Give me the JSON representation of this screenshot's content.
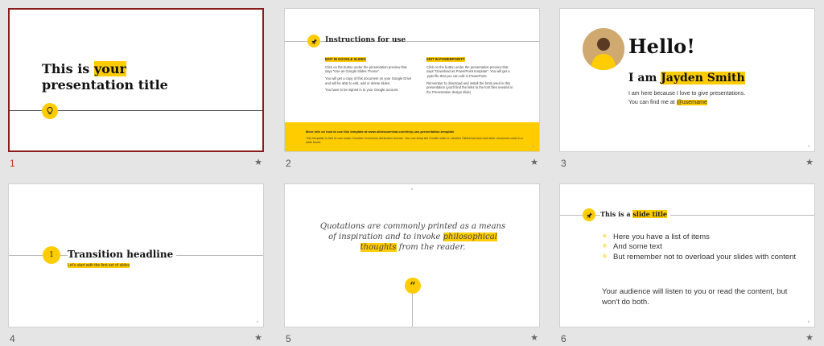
{
  "slides": [
    {
      "number": "1",
      "title_line1": "This is ",
      "title_hl": "your",
      "title_line2": "presentation title",
      "icon": "lightbulb-icon"
    },
    {
      "number": "2",
      "heading": "Instructions for use",
      "icon": "pin-icon",
      "left": {
        "label": "EDIT IN GOOGLE SLIDES",
        "p1": "Click on the button under the presentation preview that says \"Use as Google Slides Theme\".",
        "p2": "You will get a copy of this document on your Google Drive and will be able to edit, add or delete slides.",
        "p3": "You have to be signed in to your Google account."
      },
      "right": {
        "label": "EDIT IN POWERPOINT®",
        "p1": "Click on the button under the presentation preview that says \"Download as PowerPoint template\". You will get a .pptx file that you can edit in PowerPoint.",
        "p2": "Remember to download and install the fonts used in this presentation (you'll find the links to the font files needed in the Presentation design slide)"
      },
      "footer_line1": "More info on how to use this template at www.slidescarnival.com/help-use-presentation-template",
      "footer_line2": "This template is free to use under Creative Commons Attribution license. You can keep the Credits slide or mention SlidesCarnival and other resources used in a slide footer.",
      "page": "2"
    },
    {
      "number": "3",
      "hello": "Hello!",
      "iam_prefix": "I am ",
      "iam_name": "Jayden Smith",
      "line1": "I am here because I love to give presentations.",
      "line2_prefix": "You can find me at ",
      "line2_handle": "@username",
      "page": "3"
    },
    {
      "number": "4",
      "circle_num": "1",
      "title": "Transition headline",
      "subtitle": "Let's start with the first set of slides",
      "page": "4"
    },
    {
      "number": "5",
      "quote_part1": "Quotations are commonly printed as a means of inspiration and to invoke ",
      "quote_hl": "philosophical thoughts",
      "quote_part2": " from the reader.",
      "quote_mark": "“",
      "page": "5"
    },
    {
      "number": "6",
      "title_prefix": "This is a ",
      "title_hl": "slide title",
      "icon": "pin-icon",
      "items": [
        "Here you have a list of items",
        "And some text",
        "But remember not to overload your slides with content"
      ],
      "paragraph": "Your audience will listen to you or read the content, but won't do both.",
      "page": "6"
    }
  ],
  "star_glyph": "★",
  "colors": {
    "accent": "#ffcc00",
    "selected_border": "#8b1c1c"
  }
}
